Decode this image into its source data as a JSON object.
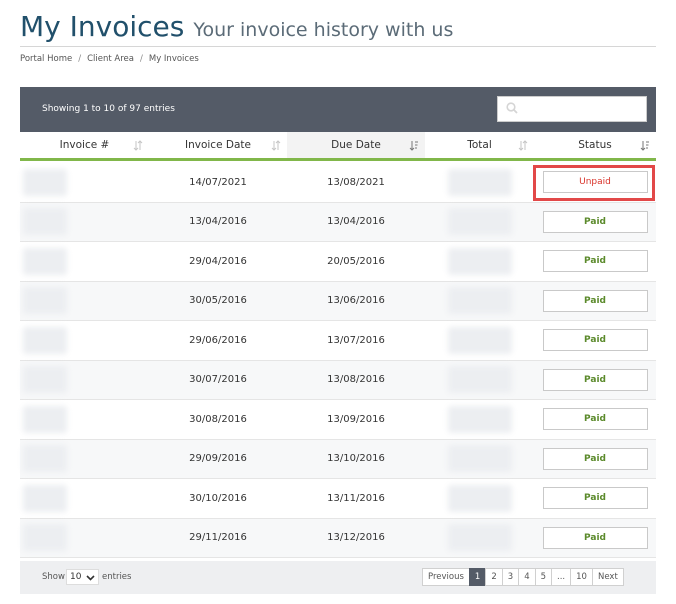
{
  "page": {
    "title": "My Invoices",
    "subtitle": "Your invoice history with us"
  },
  "breadcrumb": [
    "Portal Home",
    "Client Area",
    "My Invoices"
  ],
  "table": {
    "entries_info": "Showing 1 to 10 of 97 entries",
    "search_placeholder": "",
    "columns": [
      "Invoice #",
      "Invoice Date",
      "Due Date",
      "Total",
      "Status"
    ],
    "sorted_column": "Due Date",
    "rows": [
      {
        "invoice_date": "14/07/2021",
        "due_date": "13/08/2021",
        "status": "Unpaid"
      },
      {
        "invoice_date": "13/04/2016",
        "due_date": "13/04/2016",
        "status": "Paid"
      },
      {
        "invoice_date": "29/04/2016",
        "due_date": "20/05/2016",
        "status": "Paid"
      },
      {
        "invoice_date": "30/05/2016",
        "due_date": "13/06/2016",
        "status": "Paid"
      },
      {
        "invoice_date": "29/06/2016",
        "due_date": "13/07/2016",
        "status": "Paid"
      },
      {
        "invoice_date": "30/07/2016",
        "due_date": "13/08/2016",
        "status": "Paid"
      },
      {
        "invoice_date": "30/08/2016",
        "due_date": "13/09/2016",
        "status": "Paid"
      },
      {
        "invoice_date": "29/09/2016",
        "due_date": "13/10/2016",
        "status": "Paid"
      },
      {
        "invoice_date": "30/10/2016",
        "due_date": "13/11/2016",
        "status": "Paid"
      },
      {
        "invoice_date": "29/11/2016",
        "due_date": "13/12/2016",
        "status": "Paid"
      }
    ]
  },
  "footer": {
    "show_label": "Show",
    "entries_value": "10",
    "entries_label": "entries",
    "pagination": [
      "Previous",
      "1",
      "2",
      "3",
      "4",
      "5",
      "...",
      "10",
      "Next"
    ],
    "active_page": "1"
  },
  "colors": {
    "header_bar": "#545b67",
    "accent_green": "#81b74a",
    "paid": "#5b8a2b",
    "unpaid": "#d9342b",
    "highlight": "#e24848"
  }
}
